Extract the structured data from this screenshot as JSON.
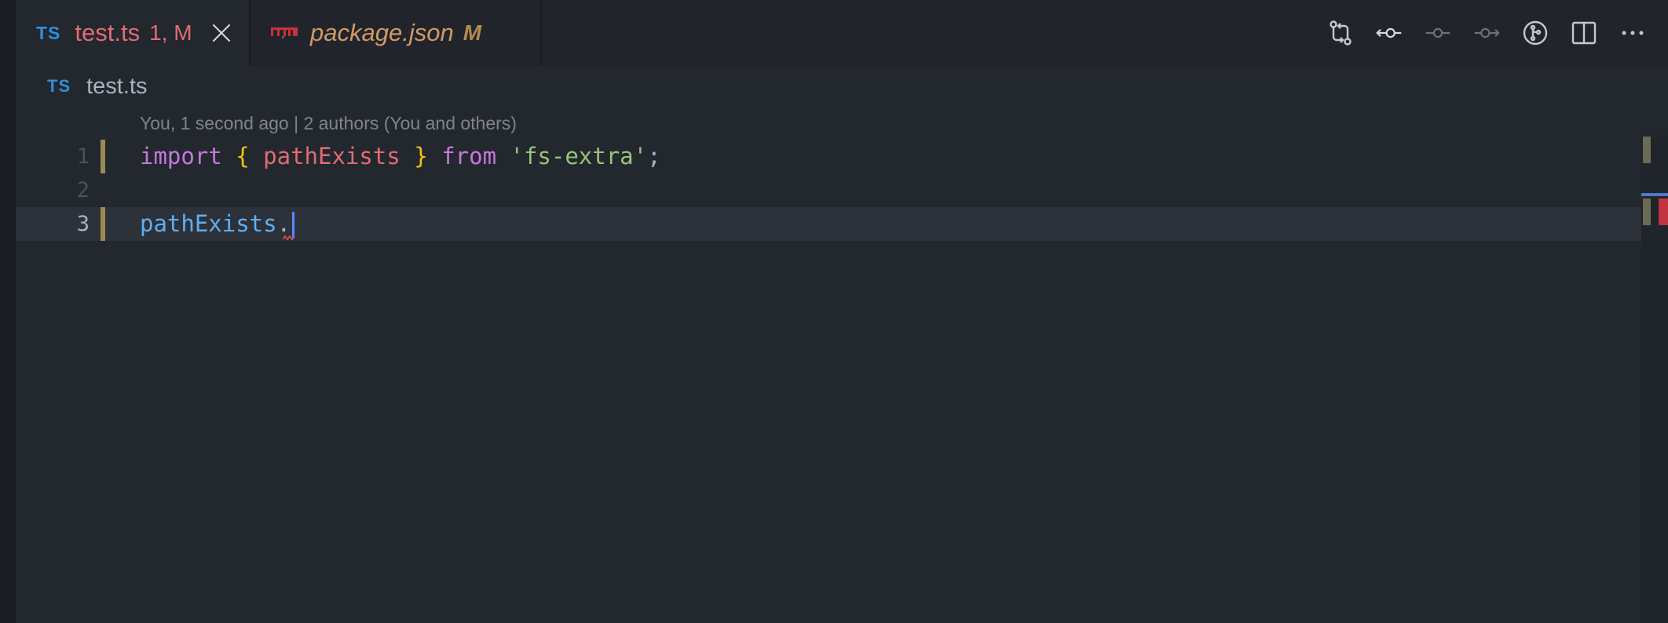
{
  "tabs": [
    {
      "icon": "typescript-file-icon",
      "glyph": "TS",
      "title": "test.ts",
      "status": "1, M",
      "active": true
    },
    {
      "icon": "npm-file-icon",
      "title": "package.json",
      "status": "M",
      "active": false
    }
  ],
  "toolbar": {
    "icons": [
      "open-changes-icon",
      "previous-revision-icon",
      "revision-commit-icon",
      "next-revision-icon",
      "git-lens-icon",
      "split-editor-icon",
      "more-actions-icon"
    ]
  },
  "breadcrumb": {
    "glyph": "TS",
    "file": "test.ts"
  },
  "editor": {
    "blame": "You, 1 second ago | 2 authors (You and others)",
    "lines": [
      {
        "number": "1",
        "tokens": [
          "import",
          "{",
          "pathExists",
          "}",
          "from",
          "'fs-extra'",
          ";"
        ]
      },
      {
        "number": "2",
        "tokens": []
      },
      {
        "number": "3",
        "tokens": [
          "pathExists",
          "."
        ]
      }
    ]
  },
  "colors": {
    "accent_blue": "#2f8fd8",
    "modified_red": "#e06c75",
    "keyword": "#c678dd",
    "string": "#98c379",
    "function": "#61afef",
    "bracket": "#f4c20d",
    "gutter_modified": "#9b8a4e",
    "error": "#c2343f"
  }
}
